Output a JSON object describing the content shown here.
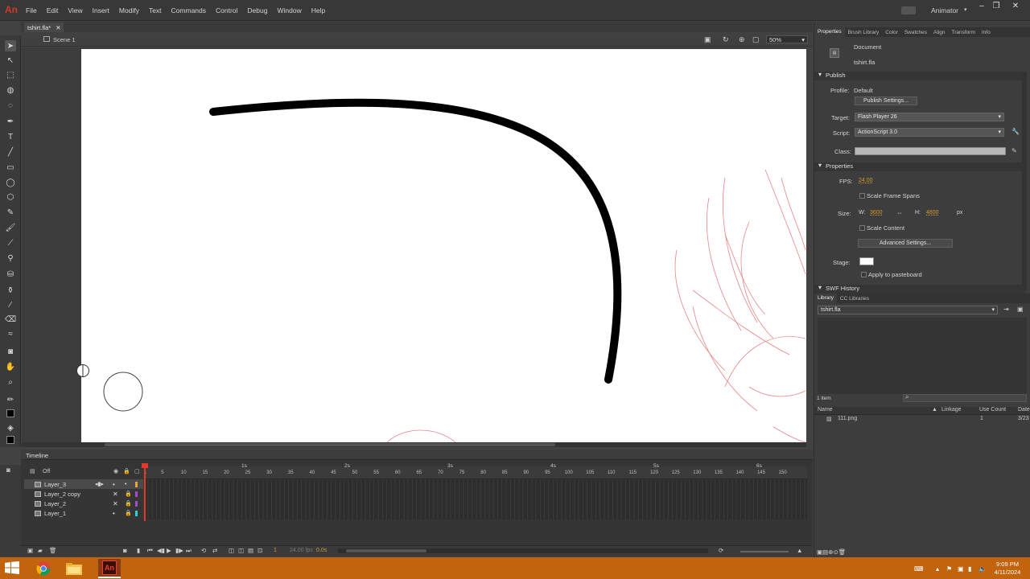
{
  "app": {
    "logo": "An",
    "workspace": "Animator",
    "window_buttons": [
      "–",
      "❐",
      "✕"
    ]
  },
  "menu": [
    "File",
    "Edit",
    "View",
    "Insert",
    "Modify",
    "Text",
    "Commands",
    "Control",
    "Debug",
    "Window",
    "Help"
  ],
  "document": {
    "tab_label": "tshirt.fla*",
    "tab_close": "✕",
    "scene": "Scene 1",
    "zoom": "50%"
  },
  "timeline": {
    "title": "Timeline",
    "onion_label": "Off",
    "ruler_seconds": [
      "1s",
      "2s",
      "3s",
      "4s",
      "5s",
      "6s"
    ],
    "ruler_frames": [
      "1",
      "5",
      "10",
      "15",
      "20",
      "25",
      "30",
      "35",
      "40",
      "45",
      "50",
      "55",
      "60",
      "65",
      "70",
      "75",
      "80",
      "85",
      "90",
      "95",
      "100",
      "105",
      "110",
      "115",
      "120",
      "125",
      "130",
      "135",
      "140",
      "145",
      "150"
    ],
    "layers": [
      {
        "name": "Layer_3",
        "color": "#e8a33a",
        "selected": true
      },
      {
        "name": "Layer_2 copy",
        "color": "#a44ad0",
        "selected": false
      },
      {
        "name": "Layer_2",
        "color": "#a44ad0",
        "selected": false
      },
      {
        "name": "Layer_1",
        "color": "#2ad0d6",
        "selected": false
      }
    ],
    "current_frame": "1",
    "fps": "24.00 fps",
    "time": "0.0s"
  },
  "properties_panel": {
    "tabs": [
      "Properties",
      "Brush Library",
      "Color",
      "Swatches",
      "Align",
      "Transform",
      "Info"
    ],
    "doc_type": "Document",
    "doc_name": "tshirt.fla",
    "publish_header": "Publish",
    "profile_label": "Profile:",
    "profile_value": "Default",
    "publish_settings_btn": "Publish Settings...",
    "target_label": "Target:",
    "target_value": "Flash Player 26",
    "script_label": "Script:",
    "script_value": "ActionScript 3.0",
    "class_label": "Class:",
    "properties_header": "Properties",
    "fps_label": "FPS:",
    "fps_value": "24.00",
    "scale_frame_spans": "Scale Frame Spans",
    "size_label": "Size:",
    "w_label": "W:",
    "w_value": "3600",
    "h_label": "H:",
    "h_value": "4800",
    "unit": "px",
    "scale_content": "Scale Content",
    "advanced_settings_btn": "Advanced Settings...",
    "stage_label": "Stage:",
    "apply_pasteboard": "Apply to pasteboard",
    "swf_history": "SWF History"
  },
  "library_panel": {
    "tabs": [
      "Library",
      "CC Libraries"
    ],
    "file": "tshirt.fla",
    "count": "1 item",
    "columns": [
      "Name",
      "Linkage",
      "Use Count",
      "Date"
    ],
    "items": [
      {
        "name": "111.png",
        "linkage": "",
        "use_count": "1",
        "date": "3/23"
      }
    ]
  },
  "taskbar": {
    "clock_time": "9:09 PM",
    "clock_date": "4/11/2024"
  },
  "colors": {
    "accent": "#d03a2a",
    "taskbar": "#c2630d",
    "fps_orange": "#d39a2f"
  }
}
